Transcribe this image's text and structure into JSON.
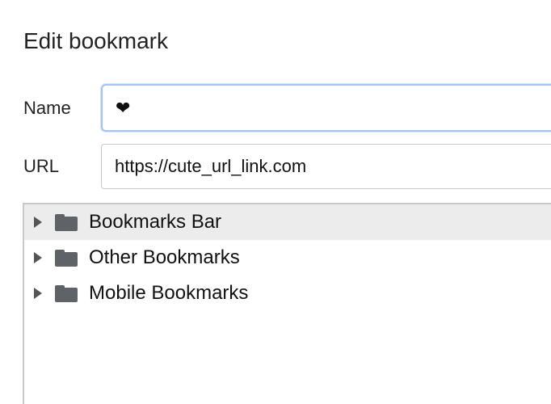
{
  "dialog": {
    "title": "Edit bookmark"
  },
  "form": {
    "name_label": "Name",
    "name_value": "❤",
    "url_label": "URL",
    "url_value": "https://cute_url_link.com"
  },
  "folder_tree": {
    "items": [
      {
        "label": "Bookmarks Bar",
        "selected": true,
        "icon": "folder-icon"
      },
      {
        "label": "Other Bookmarks",
        "selected": false,
        "icon": "folder-icon"
      },
      {
        "label": "Mobile Bookmarks",
        "selected": false,
        "icon": "folder-icon"
      }
    ]
  },
  "colors": {
    "focus_ring": "#a6c4f3",
    "selected_row": "#ececec",
    "folder_icon": "#5f6368"
  }
}
